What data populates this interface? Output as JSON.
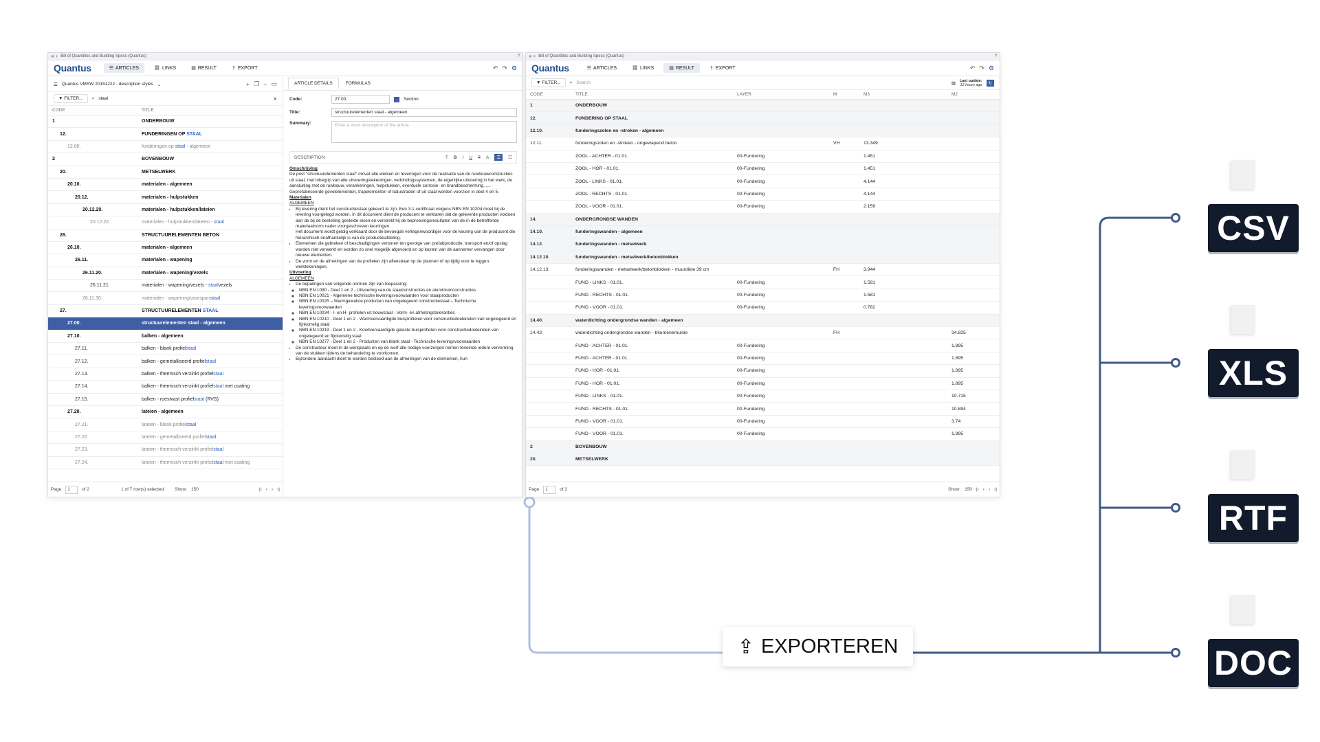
{
  "window_title": "Bill of Quantities and Building Specs (Quantus)",
  "logo": "Quantus",
  "nav": [
    "ARTICLES",
    "LINKS",
    "RESULT",
    "EXPORT"
  ],
  "left": {
    "spec": "Quantus VMSW 20151222 - description styles",
    "filter": "FILTER...",
    "search": "staal",
    "col_code": "CODE",
    "col_title": "TITLE",
    "rows": [
      {
        "c": "1",
        "t": "ONDERBOUW",
        "s": "b",
        "d": 0
      },
      {
        "c": "12.",
        "t": "FUNDERINGEN OP ",
        "h": "STAAL",
        "s": "b",
        "d": 1
      },
      {
        "c": "12.00.",
        "t": "funderingen op ",
        "h": "staal",
        "t2": " - algemeen",
        "s": "g",
        "d": 2
      },
      {
        "c": "2",
        "t": "BOVENBOUW",
        "s": "b",
        "d": 0
      },
      {
        "c": "20.",
        "t": "METSELWERK",
        "s": "b",
        "d": 1
      },
      {
        "c": "20.10.",
        "t": "materialen - algemeen",
        "s": "b",
        "d": 2
      },
      {
        "c": "20.12.",
        "t": "materialen - hulpstukken",
        "s": "b",
        "d": 3
      },
      {
        "c": "20.12.20.",
        "t": "materialen - hulpstukken/lateien",
        "s": "b",
        "d": 4
      },
      {
        "c": "20.12.22.",
        "t": "materialen - hulpstukken/lateien - ",
        "h": "staal",
        "s": "g",
        "d": 5
      },
      {
        "c": "26.",
        "t": "STRUCTUURELEMENTEN BETON",
        "s": "b",
        "d": 1
      },
      {
        "c": "26.10.",
        "t": "materialen - algemeen",
        "s": "b",
        "d": 2
      },
      {
        "c": "26.11.",
        "t": "materialen - wapening",
        "s": "b",
        "d": 3
      },
      {
        "c": "26.11.20.",
        "t": "materialen - wapening/vezels",
        "s": "b",
        "d": 4
      },
      {
        "c": "26.11.21.",
        "t": "materialen - wapening/vezels - ",
        "h": "staal",
        "t2": "vezels",
        "s": "n",
        "d": 5
      },
      {
        "c": "26.11.30.",
        "t": "materialen - wapening/voorspan",
        "h": "staal",
        "s": "g",
        "d": 4
      },
      {
        "c": "27.",
        "t": "STRUCTUURELEMENTEN ",
        "h": "STAAL",
        "s": "b",
        "d": 1
      },
      {
        "c": "27.00.",
        "t": "structuurelementen staal - algemeen",
        "s": "sel",
        "d": 2
      },
      {
        "c": "27.10.",
        "t": "balken - algemeen",
        "s": "b",
        "d": 2
      },
      {
        "c": "27.11.",
        "t": "balken - blank profiel",
        "h": "staal",
        "s": "n",
        "d": 3
      },
      {
        "c": "27.12.",
        "t": "balken - gemetalliseerd profiel",
        "h": "staal",
        "s": "n",
        "d": 3
      },
      {
        "c": "27.13.",
        "t": "balken - thermisch verzinkt profiel",
        "h": "staal",
        "s": "n",
        "d": 3
      },
      {
        "c": "27.14.",
        "t": "balken - thermisch verzinkt profiel",
        "h": "staal",
        "t2": " met coating",
        "s": "n",
        "d": 3
      },
      {
        "c": "27.15.",
        "t": "balken - roestvast profiel",
        "h": "staal",
        "t2": " (RVS)",
        "s": "n",
        "d": 3
      },
      {
        "c": "27.20.",
        "t": "lateien - algemeen",
        "s": "b",
        "d": 2
      },
      {
        "c": "27.21.",
        "t": "lateien - blank profiel",
        "h": "staal",
        "s": "g",
        "d": 3
      },
      {
        "c": "27.22.",
        "t": "lateien - gemetalliseerd profiel",
        "h": "staal",
        "s": "g",
        "d": 3
      },
      {
        "c": "27.23.",
        "t": "lateien - thermisch verzinkt profiel",
        "h": "staal",
        "s": "g",
        "d": 3
      },
      {
        "c": "27.24.",
        "t": "lateien - thermisch verzinkt profiel",
        "h": "staal",
        "t2": " met coating",
        "s": "g",
        "d": 3
      }
    ],
    "pager": {
      "page_label": "Page",
      "page": "1",
      "of": "of 2",
      "selected": "1 of 7 row(s) selected.",
      "show_label": "Show:",
      "show": "150"
    }
  },
  "detail": {
    "tabs": [
      "ARTICLE DETAILS",
      "FORMULAS"
    ],
    "code_label": "Code:",
    "code": "27.00.",
    "section_label": "Section",
    "title_label": "Title:",
    "title": "structuurelementen staal - algemeen",
    "summary_label": "Summary:",
    "summary_placeholder": "Enter a short description of the article.",
    "desc_label": "DESCRIPTION",
    "h1": "Omschrijving",
    "p1": "De post \"structuurelementen staal\" omvat alle werken en leveringen voor de realisatie van de ruwbouwconstructies uit staal, met inbegrip van alle uitvoeringstekeningen, verbindingssystemen, de eigenlijke uitvoering in het werk, de aansluiting met de ruwbouw, verankeringen, hulpstukken, eventuele corrosie- en brandbescherming, .... Geprefabriceerde gevelelementen, trapelementen of balustraden of uit staal worden voorzien in deel 4 en 5.",
    "h2": "Materialen",
    "h2a": "ALGEMEEN",
    "m1": "Bij levering dient het constructiestaal gekeurd te zijn. Een 3.1-certificaat volgens NBN EN 10204 moet bij de levering voorgelegd worden. In dit document dient de producent te verklaren dat de geleverde producten voldoen aan de bij de bestelling gestelde eisen en verstrekt hij de beproevingsresultaten van de in de betreffende materiaalnorm nader voorgeschreven keuringen.",
    "m1b": "Het document wordt geldig verklaard door de bevoegde vertegenwoordiger voor de keuring van de producent die hiërarchisch onafhankelijk is van de productieafdeling.",
    "m2": "Elementen die gebreken of beschadigingen vertonen ten gevolge van prefabproductie, transport en/of opslag worden niet verwerkt en worden zo snel mogelijk afgevoerd en op kosten van de aannemer vervangen door nieuwe elementen.",
    "m3": "De vorm en de afmetingen van de profielen zijn afleesbaar op de plannen of op tijdig voor te leggen werktekeningen.",
    "h3": "Uitvoering",
    "h3a": "ALGEMEEN",
    "u1": "De bepalingen van volgende normen zijn van toepassing:",
    "norms": [
      "NBN EN 1090 - Deel 1 en 2 - Uitvoering van de staalconstructies en aluminiumconstructies",
      "NBN EN 10021 - Algemene technische leveringsvoorwaarden voor staalproducten",
      "NBN EN 10025 – Warmgewalste producten van ongelegeerd constructiestaal – Technische leveringsvoorwaarden",
      "NBN EN 10034 - I- en H- profielen uit bouwstaal - Vorm- en afmetingstoleranties",
      "NBN EN 10210 - Deel 1 en 2 - Warmvervaardigde buisprofielen voor constructiedoeleinden van ongelegeerd en fijnkorrelig staal",
      "NBN EN 10219 - Deel 1 en 2 - Koudvervaardigde gelaste buisprofielen voor constructiedoeleinden van ongelegeerd en fijnkorrelig staal",
      "NBN EN 10277 - Deel 1 en 2 - Producten van blank staal - Technische leveringsvoorwaarden"
    ],
    "u2": "De constructeur moet in de werkplaats en op de werf alle nodige voorzorgen nemen teneinde iedere vervorming van de stukken tijdens de behandeling te voorkomen.",
    "u3": "Bijzondere aandacht dient te worden besteed aan de afmetingen van de elementen, hun"
  },
  "result": {
    "filter": "FILTER...",
    "search_placeholder": "Search",
    "last_update_label": "Last update:",
    "last_update": "12 hours ago",
    "cols": [
      "CODE",
      "TITLE",
      "LAYER",
      "M",
      "M3",
      "M2"
    ],
    "rows": [
      {
        "c": "1",
        "t": "ONDERBOUW",
        "b": true,
        "sec": true
      },
      {
        "c": "12.",
        "t": "FUNDERING OP STAAL",
        "b": true,
        "sec": true
      },
      {
        "c": "12.10.",
        "t": "funderingszolen en -stroken - algemeen",
        "b": true,
        "sec": true
      },
      {
        "c": "12.11.",
        "t": "funderingszolen en -stroken - ongewapend beton",
        "u": "VH",
        "m3": "13.349"
      },
      {
        "t": "ZOOL - ACHTER - 01.01.",
        "l": "00-Fundering",
        "m3": "1.451"
      },
      {
        "t": "ZOOL - HOR - 01.01.",
        "l": "00-Fundering",
        "m3": "1.451"
      },
      {
        "t": "ZOOL - LINKS - 01.01.",
        "l": "00-Fundering",
        "m3": "4.144"
      },
      {
        "t": "ZOOL - RECHTS - 01.01.",
        "l": "00-Fundering",
        "m3": "4.144"
      },
      {
        "t": "ZOOL - VOOR - 01.01.",
        "l": "00-Fundering",
        "m3": "2.159"
      },
      {
        "c": "14.",
        "t": "ONDERGRONDSE WANDEN",
        "b": true,
        "sec": true
      },
      {
        "c": "14.10.",
        "t": "funderingswanden - algemeen",
        "b": true,
        "sec": true
      },
      {
        "c": "14.12.",
        "t": "funderingswanden - metselwerk",
        "b": true,
        "sec": true
      },
      {
        "c": "14.12.10.",
        "t": "funderingswanden - metselwerk/betonblokken",
        "b": true,
        "sec": true
      },
      {
        "c": "14.12.13.",
        "t": "funderingswanden - metselwerk/betonblokken - muurdikte 39 cm",
        "u": "FH",
        "m3": "3.944"
      },
      {
        "t": "FUND - LINKS - 01.01.",
        "l": "00-Fundering",
        "m3": "1.581"
      },
      {
        "t": "FUND - RECHTS - 01.01.",
        "l": "00-Fundering",
        "m3": "1.581"
      },
      {
        "t": "FUND - VOOR - 01.01.",
        "l": "00-Fundering",
        "m3": "0.782"
      },
      {
        "c": "14.40.",
        "t": "waterdichting ondergrondse wanden - algemeen",
        "b": true,
        "sec": true
      },
      {
        "c": "14.43.",
        "t": "waterdichting ondergrondse wanden - bitumenemulsie",
        "u": "FH",
        "m2": "34.825"
      },
      {
        "t": "FUND - ACHTER - 01.01.",
        "l": "00-Fundering",
        "m2": "1.895"
      },
      {
        "t": "FUND - ACHTER - 01.01.",
        "l": "00-Fundering",
        "m2": "1.895"
      },
      {
        "t": "FUND - HOR - 01.01.",
        "l": "00-Fundering",
        "m2": "1.895"
      },
      {
        "t": "FUND - HOR - 01.01.",
        "l": "00-Fundering",
        "m2": "1.895"
      },
      {
        "t": "FUND - LINKS - 01.01.",
        "l": "00-Fundering",
        "m2": "10.715"
      },
      {
        "t": "FUND - RECHTS - 01.01.",
        "l": "00-Fundering",
        "m2": "10.894"
      },
      {
        "t": "FUND - VOOR - 01.01.",
        "l": "00-Fundering",
        "m2": "3.74"
      },
      {
        "t": "FUND - VOOR - 01.01.",
        "l": "00-Fundering",
        "m2": "1.895"
      },
      {
        "c": "2",
        "t": "BOVENBOUW",
        "b": true,
        "sec": true
      },
      {
        "c": "20.",
        "t": "METSELWERK",
        "b": true,
        "sec": true
      }
    ],
    "pager": {
      "page_label": "Page",
      "page": "1",
      "of": "of 2",
      "show_label": "Show:",
      "show": "150"
    }
  },
  "export_button": "EXPORTEREN",
  "formats": [
    "CSV",
    "XLS",
    "RTF",
    "DOC"
  ],
  "colors": {
    "accent": "#3f5ea3",
    "connector": "#3f5a87",
    "label_bg": "#121b2c",
    "logo": "#1f4e8c"
  }
}
